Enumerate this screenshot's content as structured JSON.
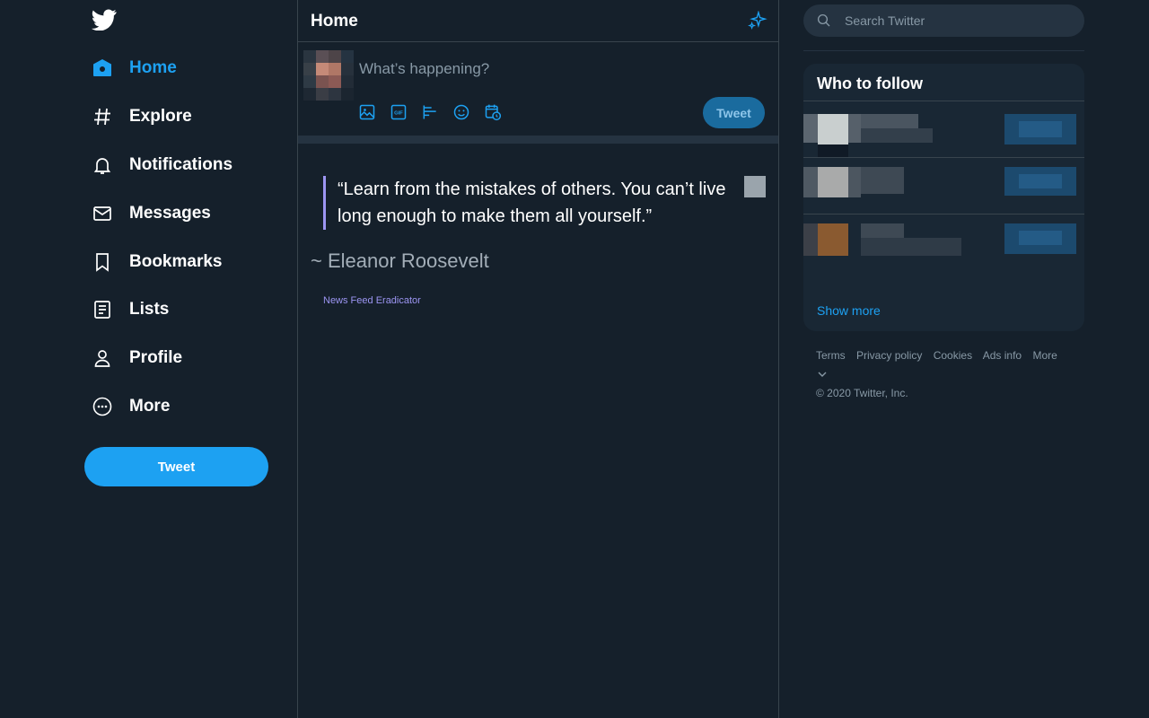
{
  "nav": {
    "items": [
      {
        "label": "Home",
        "icon": "home-icon",
        "active": true
      },
      {
        "label": "Explore",
        "icon": "hashtag-icon"
      },
      {
        "label": "Notifications",
        "icon": "bell-icon"
      },
      {
        "label": "Messages",
        "icon": "envelope-icon"
      },
      {
        "label": "Bookmarks",
        "icon": "bookmark-icon"
      },
      {
        "label": "Lists",
        "icon": "list-icon"
      },
      {
        "label": "Profile",
        "icon": "person-icon"
      },
      {
        "label": "More",
        "icon": "more-circle-icon"
      }
    ],
    "tweet_label": "Tweet"
  },
  "main": {
    "title": "Home",
    "composer": {
      "placeholder": "What’s happening?",
      "tweet_label": "Tweet",
      "icons": [
        "image-icon",
        "gif-icon",
        "poll-icon",
        "emoji-icon",
        "schedule-icon"
      ]
    },
    "quote": {
      "text": "“Learn from the mistakes of others. You can’t live long enough to make them all yourself.”",
      "author": "~ Eleanor Roosevelt",
      "credit": "News Feed Eradicator"
    }
  },
  "sidebar": {
    "search_placeholder": "Search Twitter",
    "who_to_follow": {
      "title": "Who to follow",
      "show_more": "Show more"
    },
    "footer": {
      "links": [
        "Terms",
        "Privacy policy",
        "Cookies",
        "Ads info",
        "More"
      ],
      "copyright": "© 2020 Twitter, Inc."
    }
  },
  "colors": {
    "background": "#15202b",
    "accent": "#1da1f2",
    "quote_border": "#9c95f2",
    "border": "#38444d"
  }
}
